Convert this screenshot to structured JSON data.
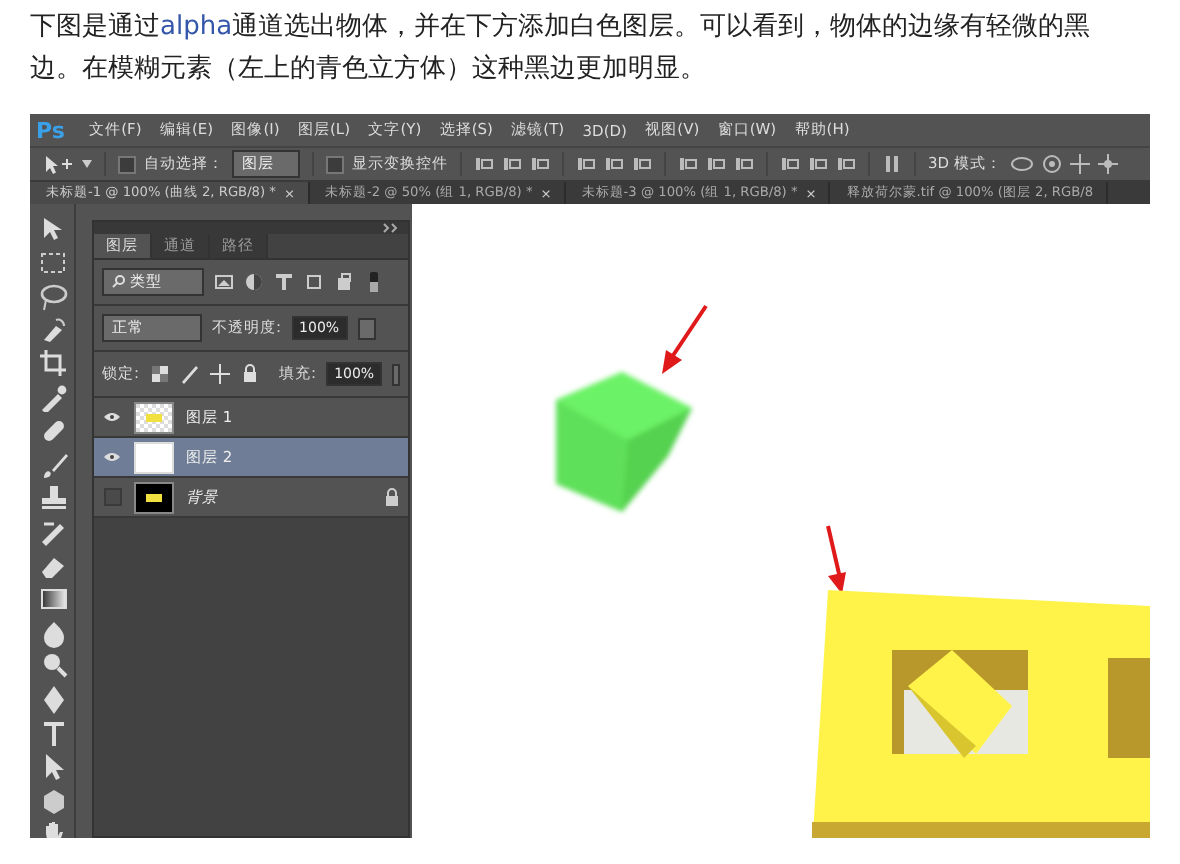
{
  "paragraph": {
    "before": "下图是通过",
    "link": "alpha",
    "after": "通道选出物体，并在下方添加白色图层。可以看到，物体的边缘有轻微的黑边。在模糊元素（左上的青色立方体）这种黑边更加明显。"
  },
  "menubar": {
    "logo": "Ps",
    "items": [
      "文件(F)",
      "编辑(E)",
      "图像(I)",
      "图层(L)",
      "文字(Y)",
      "选择(S)",
      "滤镜(T)",
      "3D(D)",
      "视图(V)",
      "窗口(W)",
      "帮助(H)"
    ]
  },
  "options_bar": {
    "auto_select": {
      "label": "自动选择：",
      "checked": false
    },
    "target": "图层",
    "show_transform": {
      "label": "显示变换控件",
      "checked": false
    },
    "mode_3d": "3D 模式："
  },
  "document_tabs": [
    {
      "label": "未标题-1 @ 100% (曲线 2, RGB/8) *",
      "close": "×",
      "selected": true
    },
    {
      "label": "未标题-2 @ 50% (组 1, RGB/8) *",
      "close": "×",
      "selected": false
    },
    {
      "label": "未标题-3 @ 100% (组 1, RGB/8) *",
      "close": "×",
      "selected": false
    },
    {
      "label": "释放荷尔蒙.tif @ 100% (图层 2, RGB/8",
      "selected": false
    }
  ],
  "layers_panel": {
    "tabs": [
      {
        "label": "图层",
        "selected": true
      },
      {
        "label": "通道",
        "selected": false
      },
      {
        "label": "路径",
        "selected": false
      }
    ],
    "filter": "类型",
    "blend_mode": "正常",
    "opacity_label": "不透明度:",
    "opacity": "100%",
    "lock_label": "锁定:",
    "fill_label": "填充:",
    "fill": "100%",
    "layers": [
      {
        "name": "图层 1",
        "kind": "transparent",
        "visible": true,
        "selected": false,
        "locked": false
      },
      {
        "name": "图层 2",
        "kind": "white",
        "visible": true,
        "selected": true,
        "locked": false
      },
      {
        "name": "背景",
        "kind": "black",
        "visible": false,
        "selected": false,
        "locked": true
      }
    ]
  }
}
